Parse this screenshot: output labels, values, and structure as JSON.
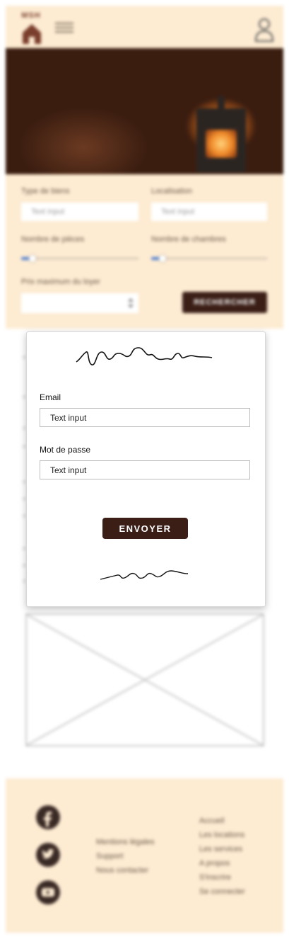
{
  "header": {
    "logo_text": "MSH"
  },
  "search": {
    "type_label": "Type de biens",
    "type_placeholder": "Text input",
    "location_label": "Localisation",
    "location_placeholder": "Text input",
    "rooms_label": "Nombre de pièces",
    "bedrooms_label": "Nombre de chambres",
    "rooms_value": 0.08,
    "bedrooms_value": 0.08,
    "max_price_label": "Prix maximum du loyer",
    "search_button": "RECHERCHER"
  },
  "login": {
    "email_label": "Email",
    "email_value": "Text input",
    "password_label": "Mot de passe",
    "password_value": "Text input",
    "submit_label": "ENVOYER"
  },
  "footer": {
    "legal_links": [
      "Mentions légales",
      "Support",
      "Nous contacter"
    ],
    "nav_links": [
      "Accueil",
      "Les locations",
      "Les services",
      "A propos",
      "S'inscrire",
      "Se connecter"
    ],
    "social_icons": [
      "facebook-icon",
      "twitter-icon",
      "youtube-icon"
    ]
  },
  "colors": {
    "accent_beige": "#fdebd2",
    "dark_brown": "#3b1f17"
  }
}
